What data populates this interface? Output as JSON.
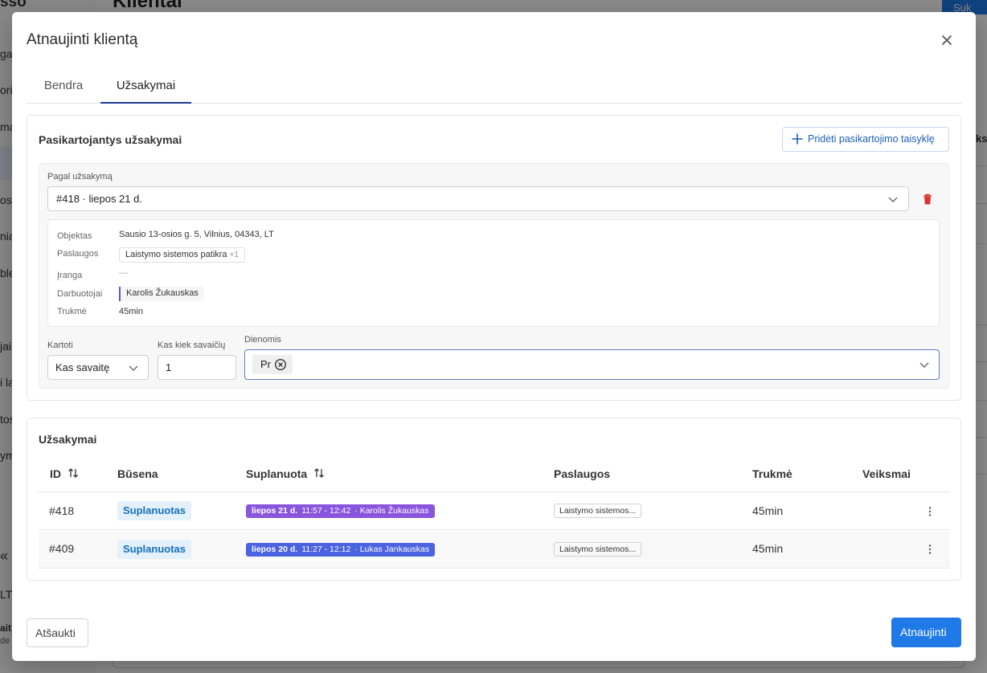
{
  "background": {
    "sidebar_fragments": [
      "sšo",
      "ga",
      "oriu",
      "ma",
      "os",
      "nia",
      "ble",
      "jai",
      "i la",
      "tos",
      "ym",
      "LT",
      "ait",
      "de"
    ],
    "page_title_fragment": "Klientai",
    "add_button_fragment": "Suk",
    "right_column_fragment": "ks",
    "collapse_glyph": "«"
  },
  "modal": {
    "title": "Atnaujinti klientą",
    "tabs": [
      {
        "label": "Bendra",
        "active": false
      },
      {
        "label": "Užsakymai",
        "active": true
      }
    ]
  },
  "recurring": {
    "title": "Pasikartojantys užsakymai",
    "add_rule_label": "Pridėti pasikartojimo taisyklę",
    "order_label": "Pagal užsakymą",
    "order_value": "#418 · liepos 21 d.",
    "details": {
      "object_label": "Objektas",
      "object_value": "Sausio 13-osios g. 5, Vilnius, 04343, LT",
      "services_label": "Paslaugos",
      "service_name": "Laistymo sistemos patikra",
      "service_qty": "×1",
      "equipment_label": "Įranga",
      "equipment_value": "—",
      "workers_label": "Darbuotojai",
      "worker_name": "Karolis Žukauskas",
      "duration_label": "Trukmė",
      "duration_value": "45min"
    },
    "repeat_label": "Kartoti",
    "repeat_value": "Kas savaitę",
    "every_weeks_label": "Kas kiek savaičių",
    "every_weeks_value": "1",
    "days_label": "Dienomis",
    "days_selected": [
      "Pr"
    ]
  },
  "orders": {
    "title": "Užsakymai",
    "columns": [
      "ID",
      "Būsena",
      "Suplanuota",
      "Paslaugos",
      "Trukmė",
      "Veiksmai"
    ],
    "rows": [
      {
        "id": "#418",
        "status": "Suplanuotas",
        "date": "liepos 21 d.",
        "time": "11:57 - 12:42",
        "worker": "· Karolis Žukauskas",
        "sched_color": "#8a55dd",
        "service": "Laistymo sistemos...",
        "duration": "45min"
      },
      {
        "id": "#409",
        "status": "Suplanuotas",
        "date": "liepos 20 d.",
        "time": "11:27 - 12:12",
        "worker": "· Lukas Jankauskas",
        "sched_color": "#4b63e0",
        "service": "Laistymo sistemos...",
        "duration": "45min"
      }
    ]
  },
  "footer": {
    "cancel_label": "Atšaukti",
    "update_label": "Atnaujinti"
  },
  "colors": {
    "primary": "#1f7ae8",
    "danger": "#e03131",
    "status_bg": "#e4f1fb",
    "status_text": "#1570b8"
  }
}
